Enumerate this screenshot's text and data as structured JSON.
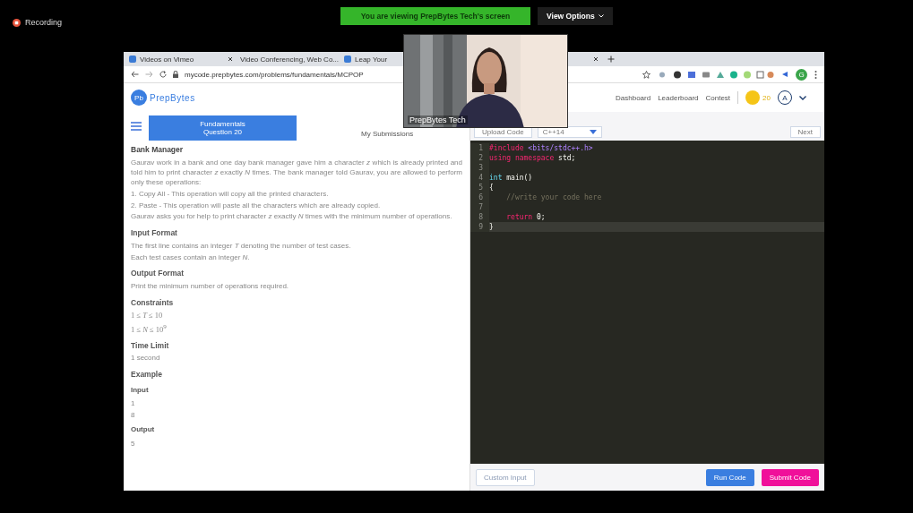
{
  "meeting": {
    "recording_label": "Recording",
    "banner": "You are viewing PrepBytes Tech's screen",
    "view_options": "View Options"
  },
  "webcam": {
    "kind": "picture",
    "name": "PrepBytes Tech"
  },
  "browser": {
    "tabs": [
      {
        "title": "Videos on Vimeo"
      },
      {
        "title": "Video Conferencing, Web Co..."
      },
      {
        "title": "Leap Your"
      }
    ],
    "url": "mycode.prepbytes.com/problems/fundamentals/MCPOP",
    "profile_initial": "G"
  },
  "site": {
    "logo": "Pb",
    "brand": "PrepBytes",
    "nav": [
      "Dashboard",
      "Leaderboard",
      "Contest"
    ],
    "coins": "20",
    "avatar": "A"
  },
  "problem_tabs": [
    {
      "label": "Fundamentals",
      "sublabel": "Question 20",
      "selected": true
    },
    {
      "label": "My Submissions",
      "selected": false
    }
  ],
  "problem": {
    "title": "Bank Manager",
    "blocks": [
      {
        "kind": "text",
        "text": "Gaurav work in a bank and one day bank manager gave him a character *z* which is already printed and told him to print character *z* exactly *N* times. The bank manager told Gaurav, you are allowed to perform only these operations:"
      },
      {
        "kind": "line",
        "text": "1. Copy All - This operation will copy all the printed characters."
      },
      {
        "kind": "line",
        "text": "2. Paste - This operation will paste all the characters which are already copied."
      },
      {
        "kind": "line",
        "text": "Gaurav asks you for help to print character *z* exactly *N* times with the minimum number of operations."
      },
      {
        "kind": "heading",
        "text": "Input Format"
      },
      {
        "kind": "line",
        "text": "The first line contains an integer *T* denoting the number of test cases."
      },
      {
        "kind": "line",
        "text": "Each test cases contain an integer *N*."
      },
      {
        "kind": "heading",
        "text": "Output Format"
      },
      {
        "kind": "line",
        "text": "Print the minimum number of operations required."
      },
      {
        "kind": "heading",
        "text": "Constraints"
      },
      {
        "kind": "math",
        "text": "1 ≤ *T* ≤ 10"
      },
      {
        "kind": "math",
        "text": "1 ≤ *N* ≤ 10$^{9}$"
      },
      {
        "kind": "heading",
        "text": "Time Limit"
      },
      {
        "kind": "line",
        "text": "1 second"
      },
      {
        "kind": "heading",
        "text": "Example"
      },
      {
        "kind": "subheading",
        "text": "Input"
      },
      {
        "kind": "line",
        "text": "1"
      },
      {
        "kind": "line",
        "text": "8"
      },
      {
        "kind": "subheading",
        "text": "Output"
      },
      {
        "kind": "line",
        "text": "5"
      }
    ]
  },
  "editor_toolbar": {
    "upload": "Upload Code",
    "language": "C++14",
    "next": "Next"
  },
  "editor": {
    "lines": [
      {
        "number": "1",
        "selected": false,
        "tokens": [
          {
            "kind": "directive",
            "text": "#include"
          },
          {
            "kind": "header",
            "text": " <bits/stdc++.h>"
          }
        ]
      },
      {
        "number": "2",
        "selected": false,
        "tokens": [
          {
            "kind": "directive",
            "text": "using namespace"
          },
          {
            "kind": "plain",
            "text": " std;"
          }
        ]
      },
      {
        "number": "3",
        "selected": false
      },
      {
        "number": "4",
        "selected": false,
        "tokens": [
          {
            "kind": "keyword",
            "text": "int"
          },
          {
            "kind": "plain",
            "text": " main()"
          }
        ]
      },
      {
        "number": "5",
        "selected": false,
        "tokens": [
          {
            "kind": "plain",
            "text": "{"
          }
        ]
      },
      {
        "number": "6",
        "selected": false,
        "tokens": [
          {
            "kind": "comment",
            "text": "    //write your code here"
          }
        ]
      },
      {
        "number": "7",
        "selected": false
      },
      {
        "number": "8",
        "selected": false,
        "tokens": [
          {
            "kind": "directive",
            "text": "    return"
          },
          {
            "kind": "plain",
            "text": " 0;"
          }
        ]
      },
      {
        "number": "9",
        "selected": true,
        "tokens": [
          {
            "kind": "plain",
            "text": "}"
          }
        ]
      }
    ]
  },
  "buttons": [
    {
      "kind": "outline",
      "label": "Custom Input"
    },
    {
      "kind": "primary",
      "label": "Run Code"
    },
    {
      "kind": "submit",
      "label": "Submit Code"
    }
  ]
}
